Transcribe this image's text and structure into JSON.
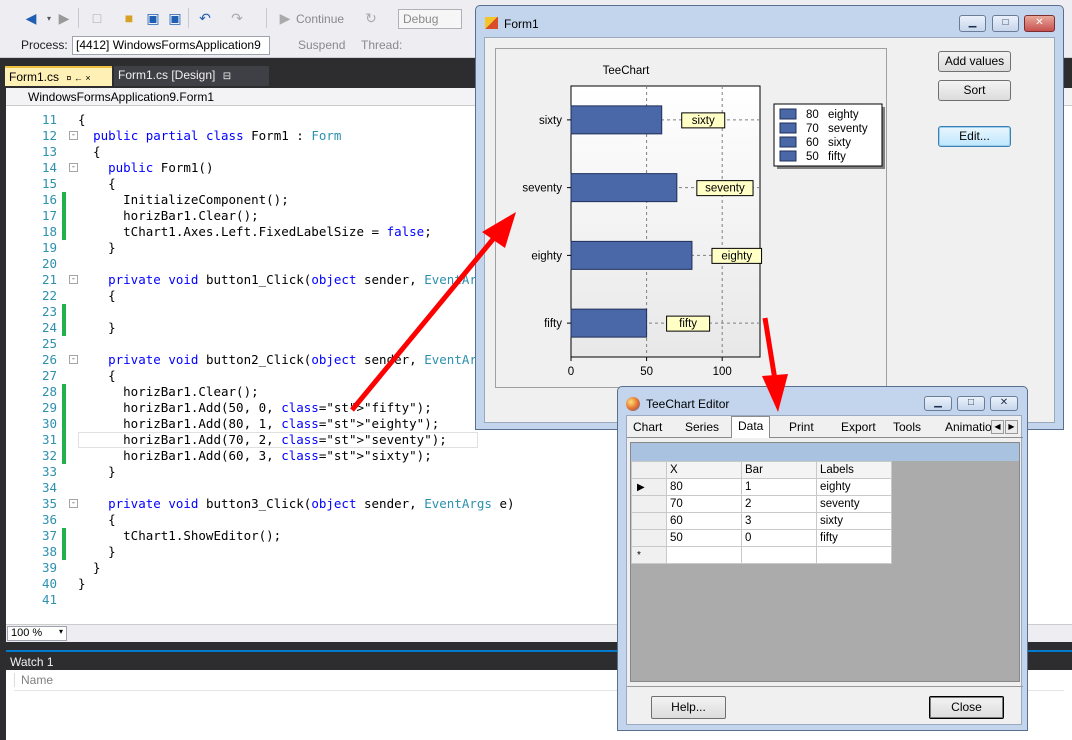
{
  "toolbar": {
    "continue_label": "Continue",
    "debug_config": "Debug",
    "process_label": "Process:",
    "process_value": "[4412] WindowsFormsApplication9",
    "suspend_label": "Suspend",
    "thread_label": "Thread:"
  },
  "tabs": [
    {
      "label": "Form1.cs",
      "pin": "¤  ←  ×"
    },
    {
      "label": "Form1.cs [Design]",
      "pin": "⊟"
    }
  ],
  "navbar": {
    "class_path": "WindowsFormsApplication9.Form1"
  },
  "code_lines": [
    {
      "num": "11",
      "text": "{",
      "changed": false,
      "fold": ""
    },
    {
      "num": "12",
      "text": "  public partial class Form1 : Form",
      "changed": false,
      "fold": "-"
    },
    {
      "num": "13",
      "text": "  {",
      "changed": false,
      "fold": ""
    },
    {
      "num": "14",
      "text": "    public Form1()",
      "changed": false,
      "fold": "-"
    },
    {
      "num": "15",
      "text": "    {",
      "changed": false,
      "fold": ""
    },
    {
      "num": "16",
      "text": "      InitializeComponent();",
      "changed": true,
      "fold": ""
    },
    {
      "num": "17",
      "text": "      horizBar1.Clear();",
      "changed": true,
      "fold": ""
    },
    {
      "num": "18",
      "text": "      tChart1.Axes.Left.FixedLabelSize = false;",
      "changed": true,
      "fold": ""
    },
    {
      "num": "19",
      "text": "    }",
      "changed": false,
      "fold": ""
    },
    {
      "num": "20",
      "text": "",
      "changed": false,
      "fold": ""
    },
    {
      "num": "21",
      "text": "    private void button1_Click(object sender, EventArgs e)",
      "changed": false,
      "fold": "-"
    },
    {
      "num": "22",
      "text": "    {",
      "changed": false,
      "fold": ""
    },
    {
      "num": "23",
      "text": "",
      "changed": true,
      "fold": ""
    },
    {
      "num": "24",
      "text": "    }",
      "changed": true,
      "fold": ""
    },
    {
      "num": "25",
      "text": "",
      "changed": false,
      "fold": ""
    },
    {
      "num": "26",
      "text": "    private void button2_Click(object sender, EventArgs e)",
      "changed": false,
      "fold": "-"
    },
    {
      "num": "27",
      "text": "    {",
      "changed": false,
      "fold": ""
    },
    {
      "num": "28",
      "text": "      horizBar1.Clear();",
      "changed": true,
      "fold": ""
    },
    {
      "num": "29",
      "text": "      horizBar1.Add(50, 0, \"fifty\");",
      "changed": true,
      "fold": ""
    },
    {
      "num": "30",
      "text": "      horizBar1.Add(80, 1, \"eighty\");",
      "changed": true,
      "fold": ""
    },
    {
      "num": "31",
      "text": "      horizBar1.Add(70, 2, \"seventy\");",
      "changed": true,
      "fold": ""
    },
    {
      "num": "32",
      "text": "      horizBar1.Add(60, 3, \"sixty\");",
      "changed": true,
      "fold": ""
    },
    {
      "num": "33",
      "text": "    }",
      "changed": false,
      "fold": ""
    },
    {
      "num": "34",
      "text": "",
      "changed": false,
      "fold": ""
    },
    {
      "num": "35",
      "text": "    private void button3_Click(object sender, EventArgs e)",
      "changed": false,
      "fold": "-"
    },
    {
      "num": "36",
      "text": "    {",
      "changed": false,
      "fold": ""
    },
    {
      "num": "37",
      "text": "      tChart1.ShowEditor();",
      "changed": true,
      "fold": ""
    },
    {
      "num": "38",
      "text": "    }",
      "changed": true,
      "fold": ""
    },
    {
      "num": "39",
      "text": "  }",
      "changed": false,
      "fold": ""
    },
    {
      "num": "40",
      "text": "}",
      "changed": false,
      "fold": ""
    },
    {
      "num": "41",
      "text": "",
      "changed": false,
      "fold": ""
    }
  ],
  "zoom": "100 %",
  "watch": {
    "title": "Watch 1",
    "col_name": "Name"
  },
  "form1": {
    "title": "Form1",
    "buttons": {
      "add_values": "Add values",
      "sort": "Sort",
      "edit": "Edit..."
    }
  },
  "chart_data": {
    "type": "bar",
    "orientation": "horizontal",
    "title": "TeeChart",
    "categories": [
      "sixty",
      "seventy",
      "eighty",
      "fifty"
    ],
    "values": [
      60,
      70,
      80,
      50
    ],
    "xlim": [
      0,
      125
    ],
    "xticks": [
      0,
      50,
      100
    ],
    "bar_color": "#4a68a8",
    "grid": true,
    "legend_placement": "right",
    "legend": [
      {
        "value": "80",
        "label": "eighty"
      },
      {
        "value": "70",
        "label": "seventy"
      },
      {
        "value": "60",
        "label": "sixty"
      },
      {
        "value": "50",
        "label": "fifty"
      }
    ]
  },
  "teechart_editor": {
    "title": "TeeChart Editor",
    "tabs": [
      "Chart",
      "Series",
      "Data",
      "Print",
      "Export",
      "Tools",
      "Animation"
    ],
    "active_tab": "Data",
    "grid_headers": [
      "X",
      "Bar",
      "Labels"
    ],
    "grid_rows": [
      {
        "x": "80",
        "bar": "1",
        "label": "eighty"
      },
      {
        "x": "70",
        "bar": "2",
        "label": "seventy"
      },
      {
        "x": "60",
        "bar": "3",
        "label": "sixty"
      },
      {
        "x": "50",
        "bar": "0",
        "label": "fifty"
      }
    ],
    "new_row_marker": "*",
    "current_row_marker": "▶",
    "help_button": "Help...",
    "close_button": "Close"
  },
  "colors": {
    "arrow": "#ff0000",
    "change_bar": "#22b14c",
    "vs_accent": "#007acc"
  }
}
